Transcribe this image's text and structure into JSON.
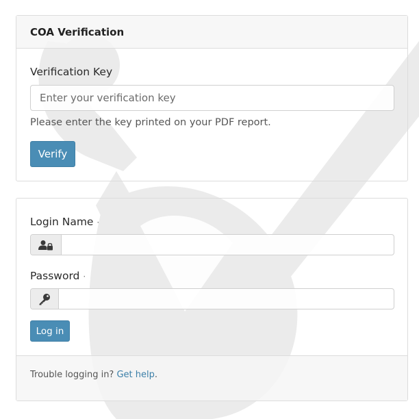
{
  "verification": {
    "title": "COA Verification",
    "key_label": "Verification Key",
    "key_placeholder": "Enter your verification key",
    "key_value": "",
    "help_text": "Please enter the key printed on your PDF report.",
    "verify_label": "Verify"
  },
  "login": {
    "login_name_label": "Login Name",
    "password_label": "Password",
    "required_marker": "·",
    "login_name_value": "",
    "password_value": "",
    "user_icon": "user-lock-icon",
    "key_icon": "key-icon",
    "login_button_label": "Log in",
    "trouble_text": "Trouble logging in?",
    "help_link_label": "Get help",
    "help_link_suffix": "."
  },
  "colors": {
    "button_bg": "#4a8db5",
    "link": "#3b7fa8",
    "watermark": "#ececec"
  }
}
